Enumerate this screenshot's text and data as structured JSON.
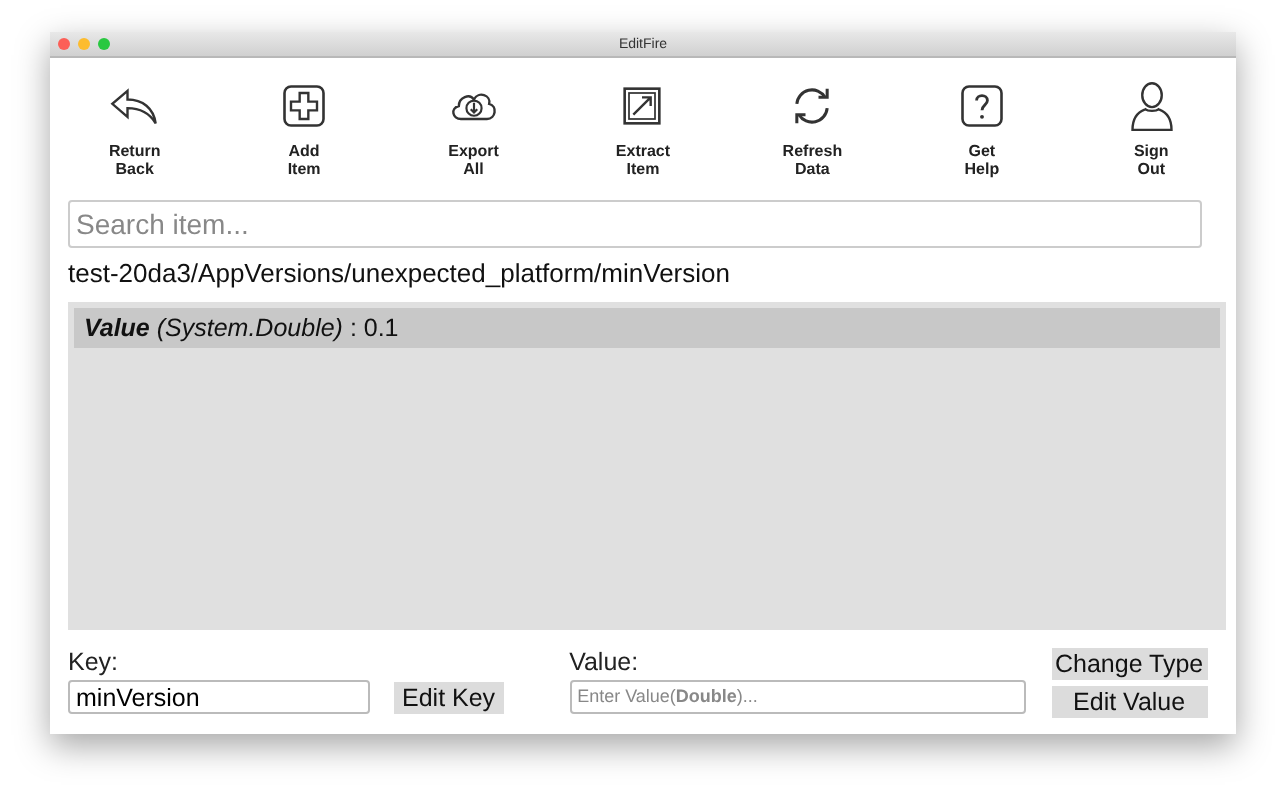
{
  "window": {
    "title": "EditFire"
  },
  "toolbar": [
    {
      "label": "Return\nBack",
      "kind": "back"
    },
    {
      "label": "Add\nItem",
      "kind": "add"
    },
    {
      "label": "Export\nAll",
      "kind": "export"
    },
    {
      "label": "Extract\nItem",
      "kind": "extract"
    },
    {
      "label": "Refresh\nData",
      "kind": "refresh"
    },
    {
      "label": "Get\nHelp",
      "kind": "help"
    },
    {
      "label": "Sign\nOut",
      "kind": "user"
    }
  ],
  "search": {
    "placeholder": "Search item..."
  },
  "path": "test-20da3/AppVersions/unexpected_platform/minVersion",
  "items": [
    {
      "name": "Value",
      "type": "(System.Double)",
      "value": " : 0.1",
      "selected": true
    }
  ],
  "key": {
    "label": "Key:",
    "value": "minVersion",
    "button": "Edit Key"
  },
  "value": {
    "label": "Value:",
    "placeholder": "Enter Value(**Double**)...",
    "change_button": "Change Type",
    "edit_button": "Edit Value"
  }
}
